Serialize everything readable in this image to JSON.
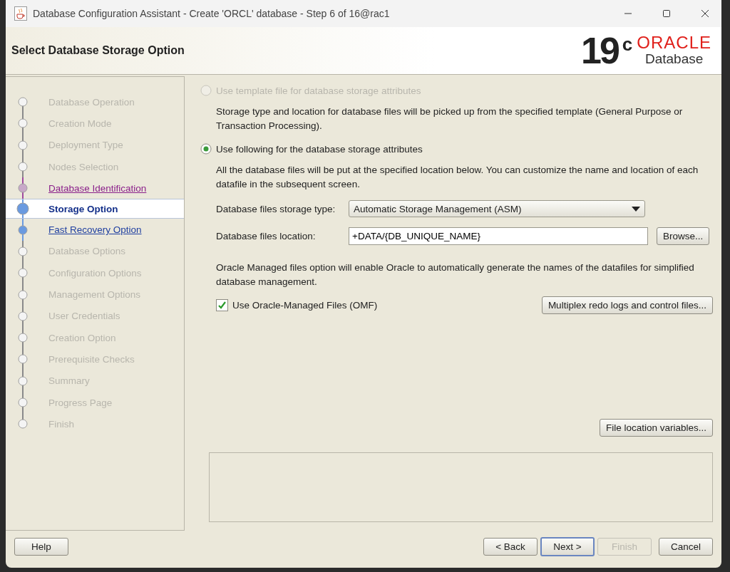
{
  "window": {
    "title": "Database Configuration Assistant - Create 'ORCL' database - Step 6 of 16@rac1"
  },
  "header": {
    "title": "Select Database Storage Option",
    "logo_version": "19",
    "logo_superscript": "c",
    "logo_brand": "ORACLE",
    "logo_product": "Database"
  },
  "steps": [
    {
      "label": "Database Operation",
      "selected": false,
      "disabled": true,
      "visited": false
    },
    {
      "label": "Creation Mode",
      "selected": false,
      "disabled": true,
      "visited": false
    },
    {
      "label": "Deployment Type",
      "selected": false,
      "disabled": true,
      "visited": false
    },
    {
      "label": "Nodes Selection",
      "selected": false,
      "disabled": true,
      "visited": false
    },
    {
      "label": "Database Identification",
      "selected": false,
      "disabled": false,
      "visited": true
    },
    {
      "label": "Storage Option",
      "selected": true,
      "disabled": false,
      "visited": false
    },
    {
      "label": "Fast Recovery Option",
      "selected": false,
      "disabled": false,
      "visited": false
    },
    {
      "label": "Database Options",
      "selected": false,
      "disabled": true,
      "visited": false
    },
    {
      "label": "Configuration Options",
      "selected": false,
      "disabled": true,
      "visited": false
    },
    {
      "label": "Management Options",
      "selected": false,
      "disabled": true,
      "visited": false
    },
    {
      "label": "User Credentials",
      "selected": false,
      "disabled": true,
      "visited": false
    },
    {
      "label": "Creation Option",
      "selected": false,
      "disabled": true,
      "visited": false
    },
    {
      "label": "Prerequisite Checks",
      "selected": false,
      "disabled": true,
      "visited": false
    },
    {
      "label": "Summary",
      "selected": false,
      "disabled": true,
      "visited": false
    },
    {
      "label": "Progress Page",
      "selected": false,
      "disabled": true,
      "visited": false
    },
    {
      "label": "Finish",
      "selected": false,
      "disabled": true,
      "visited": false
    }
  ],
  "options": [
    {
      "label": "Use template file for database storage attributes",
      "selected": false,
      "disabled": true,
      "description": "Storage type and location for database files will be picked up from the specified template (General Purpose or Transaction Processing)."
    },
    {
      "label": "Use following for the database storage attributes",
      "selected": true,
      "disabled": false,
      "description": "All the database files will be put at the specified location below. You can customize the name and location of each datafile in the subsequent screen."
    }
  ],
  "storage_type": {
    "label": "Database files storage type:",
    "value": "Automatic Storage Management (ASM)"
  },
  "location": {
    "label": "Database files location:",
    "value": "+DATA/{DB_UNIQUE_NAME}",
    "browse": "Browse..."
  },
  "omf_note": "Oracle Managed files option will enable Oracle to automatically generate the names of the datafiles for simplified database management.",
  "omf": {
    "label": "Use Oracle-Managed Files (OMF)",
    "checked": true
  },
  "multiplex_button": "Multiplex redo logs and control files...",
  "file_location_button": "File location variables...",
  "buttons": [
    {
      "label": "Help",
      "kind": "help",
      "disabled": false
    },
    {
      "label": "< Back",
      "kind": "nav",
      "disabled": false
    },
    {
      "label": "Next >",
      "kind": "default",
      "disabled": false
    },
    {
      "label": "Finish",
      "kind": "nav",
      "disabled": true
    },
    {
      "label": "Cancel",
      "kind": "nav",
      "disabled": false
    }
  ]
}
